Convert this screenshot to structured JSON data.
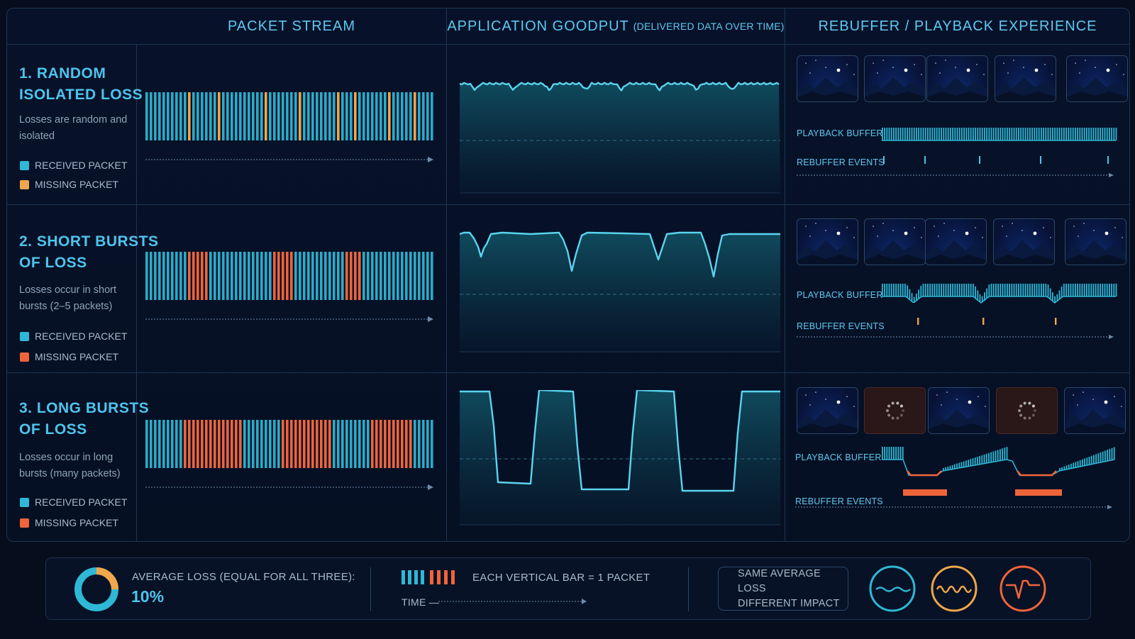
{
  "headers": {
    "packet_stream": "PACKET STREAM",
    "goodput": "APPLICATION GOODPUT",
    "goodput_sub": "(DELIVERED DATA OVER TIME)",
    "rebuffer": "REBUFFER / PLAYBACK EXPERIENCE"
  },
  "rows": [
    {
      "title": "1. RANDOM\nISOLATED LOSS",
      "desc": "Losses are random and\nisolated",
      "legend_received": "RECEIVED PACKET",
      "legend_missing": "MISSING PACKET",
      "missing_color": "#f0a64a",
      "buffer_label": "PLAYBACK BUFFER",
      "events_label": "REBUFFER EVENTS"
    },
    {
      "title": "2. SHORT BURSTS\nOF LOSS",
      "desc": "Losses occur in short\nbursts (2–5 packets)",
      "legend_received": "RECEIVED PACKET",
      "legend_missing": "MISSING PACKET",
      "missing_color": "#f0643a",
      "buffer_label": "PLAYBACK BUFFER",
      "events_label": "REBUFFER EVENTS"
    },
    {
      "title": "3. LONG BURSTS\nOF LOSS",
      "desc": "Losses occur in long\nbursts (many packets)",
      "legend_received": "RECEIVED PACKET",
      "legend_missing": "MISSING PACKET",
      "missing_color": "#f0643a",
      "buffer_label": "PLAYBACK BUFFER",
      "events_label": "REBUFFER EVENTS"
    }
  ],
  "footer": {
    "avg_loss_label": "AVERAGE LOSS (EQUAL FOR ALL THREE):",
    "avg_loss_value": "10%",
    "avg_loss_fraction": 0.1,
    "bar_legend": "EACH VERTICAL BAR  =  1 PACKET",
    "time_label": "TIME —",
    "impact_line1": "SAME AVERAGE LOSS",
    "impact_line2": "DIFFERENT IMPACT"
  },
  "colors": {
    "received": "#2fb8d6",
    "missing_isolated": "#f0a64a",
    "missing_burst": "#f0643a",
    "accent": "#4fc3ec",
    "background": "#060d1c"
  },
  "icons": [
    "donut-chart-icon",
    "calm-wave-icon",
    "choppy-wave-icon",
    "spike-wave-icon",
    "loading-spinner-icon"
  ]
}
